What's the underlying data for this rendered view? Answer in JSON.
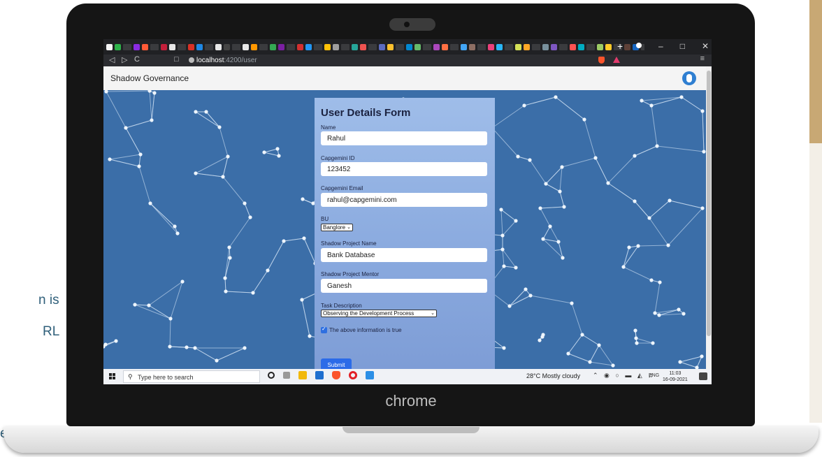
{
  "background_slide": {
    "frag1": "n is",
    "frag2": "RL",
    "frag3": "e"
  },
  "device": {
    "brand": "chrome"
  },
  "browser": {
    "url_host": "localhost",
    "url_path": ":4200/user",
    "new_tab": "+",
    "window_controls": [
      "–",
      "□",
      "✕"
    ],
    "nav": {
      "back": "◁",
      "forward": "▷",
      "reload": "C",
      "bookmark": "□",
      "menu": "≡"
    }
  },
  "app": {
    "title": "Shadow Governance"
  },
  "form": {
    "title": "User Details Form",
    "name_label": "Name",
    "name_value": "Rahul",
    "id_label": "Capgemini ID",
    "id_value": "123452",
    "email_label": "Capgemini Email",
    "email_value": "rahul@capgemini.com",
    "bu_label": "BU",
    "bu_value": "Banglore",
    "project_label": "Shadow Project Name",
    "project_value": "Bank Database",
    "mentor_label": "Shadow Project Mentor",
    "mentor_value": "Ganesh",
    "task_label": "Task Description",
    "task_value": "Observing the Development Process",
    "checkbox_label": "The above information is true",
    "checkbox_checked": true,
    "submit_label": "Submit"
  },
  "taskbar": {
    "search_placeholder": "Type here to search",
    "weather": "28°C  Mostly cloudy",
    "lang": "ENG",
    "time": "11:03",
    "date": "16-09-2021"
  },
  "colors": {
    "page_bg": "#3b6ea8",
    "form_bg": "#9fbde9",
    "accent": "#2b6be8",
    "bezel": "#151515"
  }
}
